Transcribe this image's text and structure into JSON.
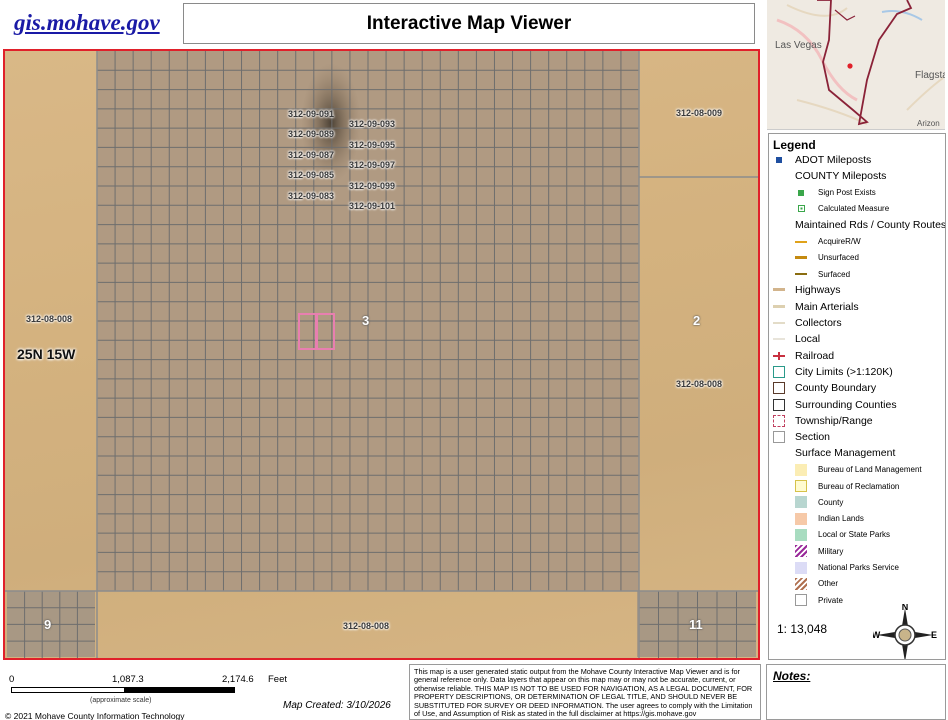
{
  "header": {
    "site_link": "gis.mohave.gov",
    "title": "Interactive Map Viewer"
  },
  "map": {
    "township_range": "25N 15W",
    "sections": [
      {
        "id": "section-3",
        "text": "3"
      },
      {
        "id": "section-2",
        "text": "2"
      },
      {
        "id": "section-9",
        "text": "9"
      },
      {
        "id": "section-11",
        "text": "11"
      }
    ],
    "parcel_labels": [
      "312-09-091",
      "312-09-089",
      "312-09-087",
      "312-09-085",
      "312-09-083",
      "312-09-093",
      "312-09-095",
      "312-09-097",
      "312-09-099",
      "312-09-101",
      "312-08-009",
      "312-08-008",
      "312-08-008",
      "312-08-008"
    ],
    "selected_parcel_color": "#e87fb0",
    "boundary_color": "#e0202a"
  },
  "inset": {
    "labels": [
      "Las Vegas",
      "Flagsta",
      "Arizon"
    ]
  },
  "legend": {
    "title": "Legend",
    "items": [
      {
        "label": "ADOT Mileposts",
        "size": "h",
        "swatch": "square-blue",
        "color": "#1f4fa0"
      },
      {
        "label": "COUNTY Mileposts",
        "size": "h",
        "swatch": "none"
      },
      {
        "label": "Sign Post Exists",
        "size": "s",
        "swatch": "square-green",
        "color": "#3aa64a"
      },
      {
        "label": "Calculated Measure",
        "size": "s",
        "swatch": "dot-green",
        "color": "#3aa64a"
      },
      {
        "label": "Maintained Rds / County Routes",
        "size": "h",
        "swatch": "none"
      },
      {
        "label": "AcquireR/W",
        "size": "s",
        "swatch": "line",
        "color": "#e0a21a"
      },
      {
        "label": "Unsurfaced",
        "size": "s",
        "swatch": "line-thick",
        "color": "#c48a10"
      },
      {
        "label": "Surfaced",
        "size": "s",
        "swatch": "line",
        "color": "#8a6d10"
      },
      {
        "label": "Highways",
        "size": "h",
        "swatch": "line-thick",
        "color": "#d2b48c"
      },
      {
        "label": "Main Arterials",
        "size": "h",
        "swatch": "line-thick",
        "color": "#ddd0b0"
      },
      {
        "label": "Collectors",
        "size": "h",
        "swatch": "line",
        "color": "#e3dcc8"
      },
      {
        "label": "Local",
        "size": "h",
        "swatch": "line",
        "color": "#e8e4da"
      },
      {
        "label": "Railroad",
        "size": "h",
        "swatch": "railroad",
        "color": "#c83040"
      },
      {
        "label": "City Limits (>1:120K)",
        "size": "h",
        "swatch": "box",
        "color": "#2a9a8a"
      },
      {
        "label": "County Boundary",
        "size": "h",
        "swatch": "box",
        "color": "#5a3a2a"
      },
      {
        "label": "Surrounding Counties",
        "size": "h",
        "swatch": "box",
        "color": "#333333"
      },
      {
        "label": "Township/Range",
        "size": "h",
        "swatch": "box-dashed",
        "color": "#c04060"
      },
      {
        "label": "Section",
        "size": "h",
        "swatch": "box",
        "color": "#999999"
      },
      {
        "label": "Surface Management",
        "size": "h",
        "swatch": "none"
      },
      {
        "label": "Bureau of Land Management",
        "size": "s",
        "swatch": "fill",
        "color": "#fbedb4"
      },
      {
        "label": "Bureau of Reclamation",
        "size": "s",
        "swatch": "fill-border",
        "color": "#fffbd0",
        "border": "#d6c24a"
      },
      {
        "label": "County",
        "size": "s",
        "swatch": "fill",
        "color": "#b8d6d0"
      },
      {
        "label": "Indian Lands",
        "size": "s",
        "swatch": "fill",
        "color": "#f6c9a8"
      },
      {
        "label": "Local or State Parks",
        "size": "s",
        "swatch": "fill",
        "color": "#a8dcc0"
      },
      {
        "label": "Military",
        "size": "s",
        "swatch": "hatch",
        "color": "#9a2a9a"
      },
      {
        "label": "National Parks Service",
        "size": "s",
        "swatch": "fill",
        "color": "#dcdcf6"
      },
      {
        "label": "Other",
        "size": "s",
        "swatch": "hatch",
        "color": "#b07050"
      },
      {
        "label": "Private",
        "size": "s",
        "swatch": "fill-border",
        "color": "#ffffff",
        "border": "#999999"
      }
    ],
    "scale_ratio": "1: 13,048",
    "compass": {
      "n": "N",
      "s": "S",
      "e": "E",
      "w": "W"
    }
  },
  "scalebar": {
    "tick_0": "0",
    "tick_1": "1,087.3",
    "tick_2": "2,174.6",
    "unit": "Feet",
    "approx": "(approximate scale)"
  },
  "footer": {
    "map_created": "Map Created: 3/10/2026",
    "copyright": "© 2021 Mohave County Information Technology",
    "disclaimer": "This map is a user generated static output from the Mohave County Interactive Map Viewer and is for general reference only. Data layers that appear on this map may or may not be accurate, current, or otherwise reliable. THIS MAP IS NOT TO BE USED FOR NAVIGATION, AS A LEGAL DOCUMENT, FOR PROPERTY DESCRIPTIONS, OR DETERMINATION OF LEGAL TITLE, AND SHOULD NEVER BE SUBSTITUTED FOR SURVEY OR DEED INFORMATION. The user agrees to comply with the Limitation of Use, and Assumption of Risk as stated in the full disclaimer at https://gis.mohave.gov",
    "notes_title": "Notes:"
  }
}
